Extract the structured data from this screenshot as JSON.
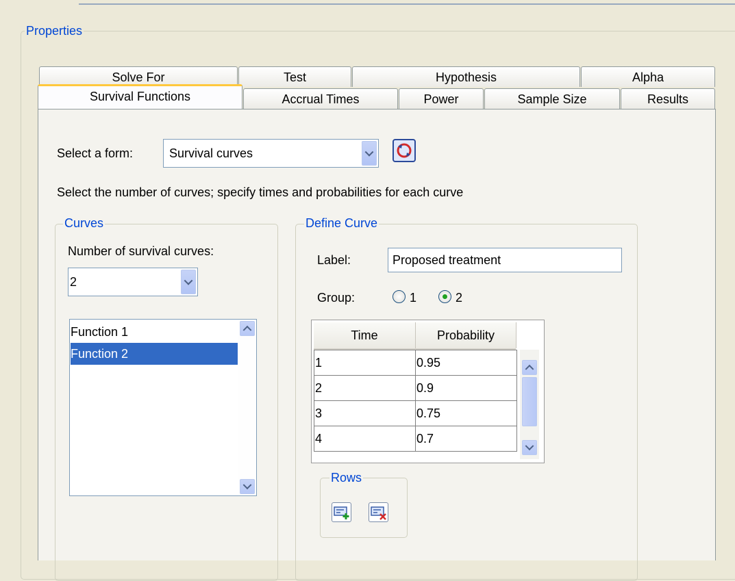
{
  "properties": {
    "title": "Properties"
  },
  "tabs": {
    "row_back": [
      "Solve For",
      "Test",
      "Hypothesis",
      "Alpha"
    ],
    "row_front": [
      "Survival Functions",
      "Accrual Times",
      "Power",
      "Sample Size",
      "Results"
    ],
    "active": "Survival Functions"
  },
  "form": {
    "label": "Select a form:",
    "selected": "Survival curves",
    "instruction": "Select the number of curves; specify times and probabilities for each curve"
  },
  "curves": {
    "title": "Curves",
    "count_label": "Number of survival curves:",
    "count_value": "2",
    "items": [
      "Function 1",
      "Function 2"
    ],
    "selected_index": 1
  },
  "define_curve": {
    "title": "Define Curve",
    "label_caption": "Label:",
    "label_value": "Proposed treatment",
    "group_caption": "Group:",
    "group_options": [
      "1",
      "2"
    ],
    "group_selected": "2",
    "table": {
      "headers": [
        "Time",
        "Probability"
      ],
      "rows": [
        [
          "1",
          "0.95"
        ],
        [
          "2",
          "0.9"
        ],
        [
          "3",
          "0.75"
        ],
        [
          "4",
          "0.7"
        ]
      ]
    },
    "rows_box_title": "Rows"
  },
  "icons": {
    "refresh": "refresh-icon",
    "add_row": "add-row-icon",
    "delete_row": "delete-row-icon"
  }
}
